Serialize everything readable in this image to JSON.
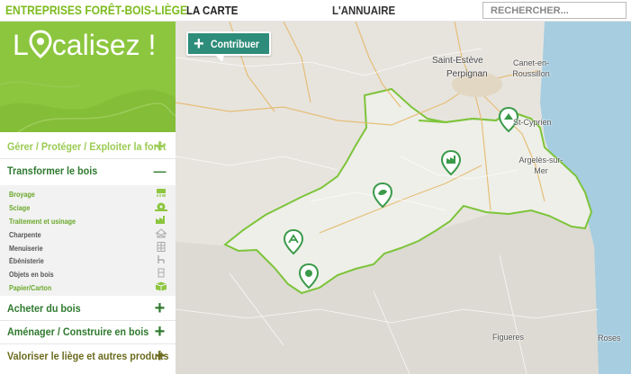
{
  "header": {
    "brand": "ENTREPRISES FORÊT-BOIS-LIÈGE",
    "nav_carte": "LA CARTE",
    "nav_annuaire": "L'ANNUAIRE",
    "search_placeholder": "RECHERCHER..."
  },
  "sidebar": {
    "hero_title_prefix": "L",
    "hero_title_suffix": "calisez !",
    "categories": [
      {
        "label": "Gérer / Protéger / Exploiter la forêt",
        "toggle": "+"
      },
      {
        "label": "Transformer le bois",
        "toggle": "—"
      },
      {
        "label": "Acheter du bois",
        "toggle": "+"
      },
      {
        "label": "Aménager / Construire en bois",
        "toggle": "+"
      },
      {
        "label": "Valoriser le liège et autres produits",
        "toggle": "+"
      }
    ],
    "subcategories": [
      {
        "label": "Broyage",
        "active": true,
        "icon": "shredder-icon"
      },
      {
        "label": "Sciage",
        "active": true,
        "icon": "saw-icon"
      },
      {
        "label": "Traitement et usinage",
        "active": true,
        "icon": "factory-icon"
      },
      {
        "label": "Charpente",
        "active": false,
        "icon": "house-frame-icon"
      },
      {
        "label": "Menuiserie",
        "active": false,
        "icon": "window-frame-icon"
      },
      {
        "label": "Ébénisterie",
        "active": false,
        "icon": "chair-icon"
      },
      {
        "label": "Objets en bois",
        "active": false,
        "icon": "object-icon"
      },
      {
        "label": "Papier/Carton",
        "active": true,
        "icon": "box-icon"
      }
    ]
  },
  "map": {
    "contribute_label": "Contribuer",
    "contribute_icon": "plus-icon",
    "colors": {
      "boundary": "#7dc43a",
      "marker": "#3a9a4a",
      "sea": "#9fc7d9"
    },
    "places": [
      "Saint-Estève",
      "Perpignan",
      "Canet-en-Roussillon",
      "St-Cyprien",
      "Argelès-sur-Mer",
      "Figueres",
      "Roses"
    ],
    "markers": [
      "saw-marker",
      "factory-marker",
      "leaf-marker",
      "sawmill-marker",
      "shredder-marker",
      "forest-marker"
    ]
  }
}
